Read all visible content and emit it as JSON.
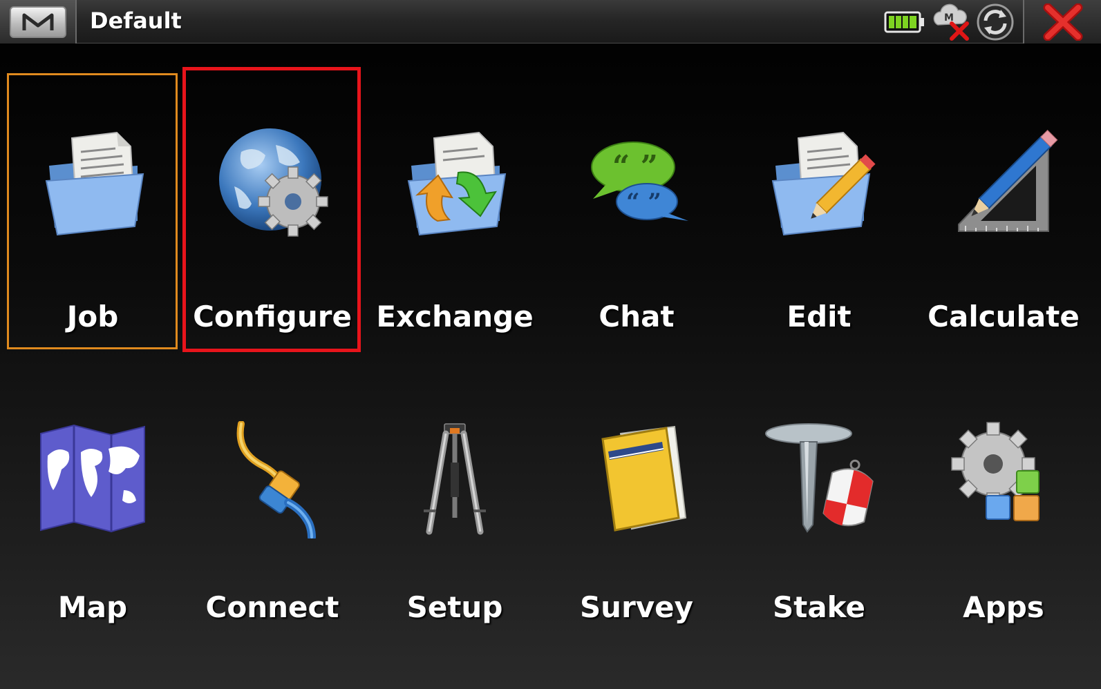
{
  "titlebar": {
    "title": "Default",
    "menu_icon": "m-logo-icon",
    "status_icons": [
      "battery-icon",
      "cloud-disconnected-icon",
      "sync-icon"
    ],
    "close_icon": "close-icon"
  },
  "tiles": [
    {
      "label": "Job",
      "icon": "folder-document-icon"
    },
    {
      "label": "Configure",
      "icon": "globe-gear-icon"
    },
    {
      "label": "Exchange",
      "icon": "folder-exchange-icon"
    },
    {
      "label": "Chat",
      "icon": "chat-bubbles-icon"
    },
    {
      "label": "Edit",
      "icon": "folder-pencil-icon"
    },
    {
      "label": "Calculate",
      "icon": "pencil-ruler-icon"
    },
    {
      "label": "Map",
      "icon": "world-map-icon"
    },
    {
      "label": "Connect",
      "icon": "cable-plug-icon"
    },
    {
      "label": "Setup",
      "icon": "tripod-icon"
    },
    {
      "label": "Survey",
      "icon": "field-book-icon"
    },
    {
      "label": "Stake",
      "icon": "survey-stake-icon"
    },
    {
      "label": "Apps",
      "icon": "gear-blocks-icon"
    }
  ],
  "colors": {
    "focus_border": "#e08a1e",
    "selection_border": "#e8141b",
    "battery_green": "#7ed321",
    "close_red": "#d9201e"
  }
}
